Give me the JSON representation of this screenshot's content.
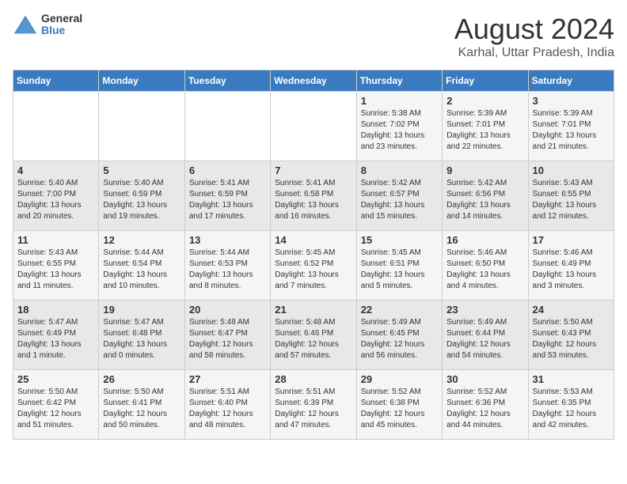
{
  "header": {
    "logo_general": "General",
    "logo_blue": "Blue",
    "month_year": "August 2024",
    "location": "Karhal, Uttar Pradesh, India"
  },
  "days_of_week": [
    "Sunday",
    "Monday",
    "Tuesday",
    "Wednesday",
    "Thursday",
    "Friday",
    "Saturday"
  ],
  "weeks": [
    [
      {
        "num": "",
        "info": ""
      },
      {
        "num": "",
        "info": ""
      },
      {
        "num": "",
        "info": ""
      },
      {
        "num": "",
        "info": ""
      },
      {
        "num": "1",
        "info": "Sunrise: 5:38 AM\nSunset: 7:02 PM\nDaylight: 13 hours\nand 23 minutes."
      },
      {
        "num": "2",
        "info": "Sunrise: 5:39 AM\nSunset: 7:01 PM\nDaylight: 13 hours\nand 22 minutes."
      },
      {
        "num": "3",
        "info": "Sunrise: 5:39 AM\nSunset: 7:01 PM\nDaylight: 13 hours\nand 21 minutes."
      }
    ],
    [
      {
        "num": "4",
        "info": "Sunrise: 5:40 AM\nSunset: 7:00 PM\nDaylight: 13 hours\nand 20 minutes."
      },
      {
        "num": "5",
        "info": "Sunrise: 5:40 AM\nSunset: 6:59 PM\nDaylight: 13 hours\nand 19 minutes."
      },
      {
        "num": "6",
        "info": "Sunrise: 5:41 AM\nSunset: 6:59 PM\nDaylight: 13 hours\nand 17 minutes."
      },
      {
        "num": "7",
        "info": "Sunrise: 5:41 AM\nSunset: 6:58 PM\nDaylight: 13 hours\nand 16 minutes."
      },
      {
        "num": "8",
        "info": "Sunrise: 5:42 AM\nSunset: 6:57 PM\nDaylight: 13 hours\nand 15 minutes."
      },
      {
        "num": "9",
        "info": "Sunrise: 5:42 AM\nSunset: 6:56 PM\nDaylight: 13 hours\nand 14 minutes."
      },
      {
        "num": "10",
        "info": "Sunrise: 5:43 AM\nSunset: 6:55 PM\nDaylight: 13 hours\nand 12 minutes."
      }
    ],
    [
      {
        "num": "11",
        "info": "Sunrise: 5:43 AM\nSunset: 6:55 PM\nDaylight: 13 hours\nand 11 minutes."
      },
      {
        "num": "12",
        "info": "Sunrise: 5:44 AM\nSunset: 6:54 PM\nDaylight: 13 hours\nand 10 minutes."
      },
      {
        "num": "13",
        "info": "Sunrise: 5:44 AM\nSunset: 6:53 PM\nDaylight: 13 hours\nand 8 minutes."
      },
      {
        "num": "14",
        "info": "Sunrise: 5:45 AM\nSunset: 6:52 PM\nDaylight: 13 hours\nand 7 minutes."
      },
      {
        "num": "15",
        "info": "Sunrise: 5:45 AM\nSunset: 6:51 PM\nDaylight: 13 hours\nand 5 minutes."
      },
      {
        "num": "16",
        "info": "Sunrise: 5:46 AM\nSunset: 6:50 PM\nDaylight: 13 hours\nand 4 minutes."
      },
      {
        "num": "17",
        "info": "Sunrise: 5:46 AM\nSunset: 6:49 PM\nDaylight: 13 hours\nand 3 minutes."
      }
    ],
    [
      {
        "num": "18",
        "info": "Sunrise: 5:47 AM\nSunset: 6:49 PM\nDaylight: 13 hours\nand 1 minute."
      },
      {
        "num": "19",
        "info": "Sunrise: 5:47 AM\nSunset: 6:48 PM\nDaylight: 13 hours\nand 0 minutes."
      },
      {
        "num": "20",
        "info": "Sunrise: 5:48 AM\nSunset: 6:47 PM\nDaylight: 12 hours\nand 58 minutes."
      },
      {
        "num": "21",
        "info": "Sunrise: 5:48 AM\nSunset: 6:46 PM\nDaylight: 12 hours\nand 57 minutes."
      },
      {
        "num": "22",
        "info": "Sunrise: 5:49 AM\nSunset: 6:45 PM\nDaylight: 12 hours\nand 56 minutes."
      },
      {
        "num": "23",
        "info": "Sunrise: 5:49 AM\nSunset: 6:44 PM\nDaylight: 12 hours\nand 54 minutes."
      },
      {
        "num": "24",
        "info": "Sunrise: 5:50 AM\nSunset: 6:43 PM\nDaylight: 12 hours\nand 53 minutes."
      }
    ],
    [
      {
        "num": "25",
        "info": "Sunrise: 5:50 AM\nSunset: 6:42 PM\nDaylight: 12 hours\nand 51 minutes."
      },
      {
        "num": "26",
        "info": "Sunrise: 5:50 AM\nSunset: 6:41 PM\nDaylight: 12 hours\nand 50 minutes."
      },
      {
        "num": "27",
        "info": "Sunrise: 5:51 AM\nSunset: 6:40 PM\nDaylight: 12 hours\nand 48 minutes."
      },
      {
        "num": "28",
        "info": "Sunrise: 5:51 AM\nSunset: 6:39 PM\nDaylight: 12 hours\nand 47 minutes."
      },
      {
        "num": "29",
        "info": "Sunrise: 5:52 AM\nSunset: 6:38 PM\nDaylight: 12 hours\nand 45 minutes."
      },
      {
        "num": "30",
        "info": "Sunrise: 5:52 AM\nSunset: 6:36 PM\nDaylight: 12 hours\nand 44 minutes."
      },
      {
        "num": "31",
        "info": "Sunrise: 5:53 AM\nSunset: 6:35 PM\nDaylight: 12 hours\nand 42 minutes."
      }
    ]
  ]
}
